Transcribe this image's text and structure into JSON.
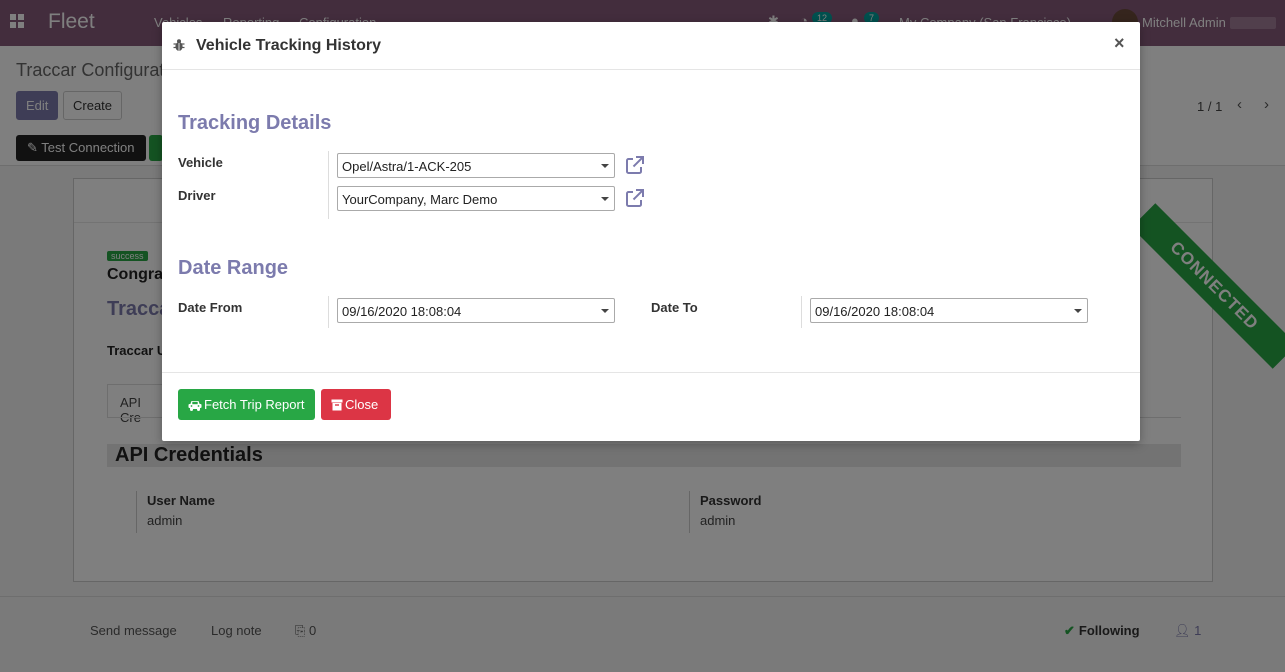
{
  "topbar": {
    "app_name": "Fleet",
    "menus": [
      "Vehicles",
      "Reporting",
      "Configuration"
    ],
    "activity_count": "12",
    "message_count": "7",
    "company": "My Company (San Francisco)",
    "user": "Mitchell Admin"
  },
  "control_panel": {
    "title": "Traccar Configurat",
    "edit_label": "Edit",
    "create_label": "Create",
    "pager": "1 / 1",
    "test_connection_label": "Test Connection"
  },
  "sheet": {
    "status_badge": "success",
    "congrats_text": "Congra",
    "heading": "Tracca",
    "url_label": "Traccar U",
    "ribbon": "CONNECTED",
    "tab_label": "API Cre",
    "section_title": "API Credentials",
    "username_label": "User Name",
    "username_value": "admin",
    "password_label": "Password",
    "password_value": "admin"
  },
  "chatter": {
    "send_message": "Send message",
    "log_note": "Log note",
    "attachments": "0",
    "following": "Following",
    "followers": "1"
  },
  "modal": {
    "title": "Vehicle Tracking History",
    "close_symbol": "×",
    "tracking_section": "Tracking Details",
    "vehicle_label": "Vehicle",
    "vehicle_value": "Opel/Astra/1-ACK-205",
    "driver_label": "Driver",
    "driver_value": "YourCompany, Marc Demo",
    "date_section": "Date Range",
    "date_from_label": "Date From",
    "date_from_value": "09/16/2020 18:08:04",
    "date_to_label": "Date To",
    "date_to_value": "09/16/2020 18:08:04",
    "fetch_label": "Fetch Trip Report",
    "close_label": "Close"
  },
  "colors": {
    "brand": "#875a7b",
    "accent": "#7c7bad",
    "success": "#28a745",
    "danger": "#dc3545"
  },
  "icons": [
    "apps-icon",
    "bug-icon",
    "external-link-icon",
    "car-icon",
    "archive-icon",
    "check-icon",
    "paperclip-icon",
    "user-icon",
    "chevron-left-icon",
    "chevron-right-icon",
    "edit-icon"
  ]
}
